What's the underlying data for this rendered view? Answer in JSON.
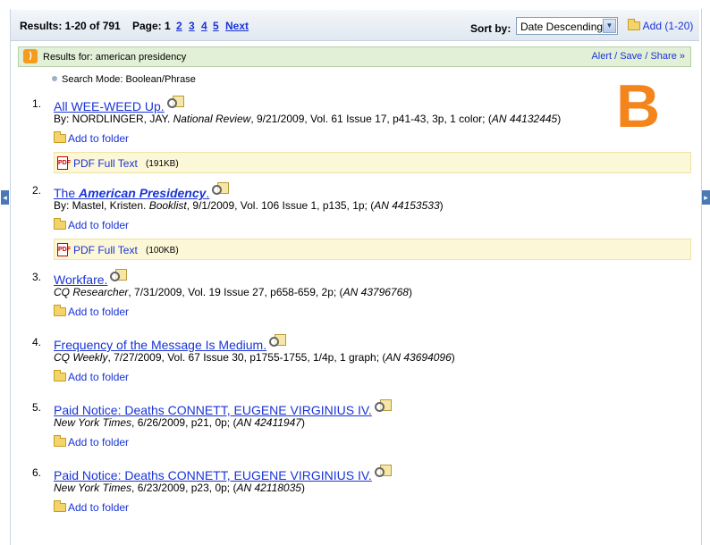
{
  "toolbar": {
    "results_count": "Results: 1-20 of 791",
    "page_label": "Page: 1",
    "pages": [
      "2",
      "3",
      "4",
      "5"
    ],
    "next": "Next",
    "sort_label": "Sort by:",
    "sort_value": "Date Descending",
    "add_label": "Add (1-20)"
  },
  "results_for": {
    "label": "Results for:",
    "query": "american presidency",
    "alert_link": "Alert / Save / Share »"
  },
  "search_mode": "Search Mode: Boolean/Phrase",
  "overlay_letter": "B",
  "add_to_folder": "Add to folder",
  "pdf_full_text": "PDF Full Text",
  "results": [
    {
      "num": "1.",
      "title": "All WEE-WEED Up.",
      "by": "By: NORDLINGER, JAY. ",
      "source": "National Review",
      "details": ", 9/21/2009, Vol. 61 Issue 17, p41-43, 3p, 1 color; (",
      "an": "AN 44132445",
      "close": ")",
      "pdf_size": "(191KB)"
    },
    {
      "num": "2.",
      "title_prefix": "The ",
      "title_emph": "American Presidency",
      "title_suffix": ".",
      "by": "By: Mastel, Kristen. ",
      "source": "Booklist",
      "details": ", 9/1/2009, Vol. 106 Issue 1, p135, 1p; (",
      "an": "AN 44153533",
      "close": ")",
      "pdf_size": "(100KB)"
    },
    {
      "num": "3.",
      "title": "Workfare.",
      "source": "CQ Researcher",
      "details": ", 7/31/2009, Vol. 19 Issue 27, p658-659, 2p; (",
      "an": "AN 43796768",
      "close": ")"
    },
    {
      "num": "4.",
      "title": "Frequency of the Message Is Medium.",
      "source": "CQ Weekly",
      "details": ", 7/27/2009, Vol. 67 Issue 30, p1755-1755, 1/4p, 1 graph; (",
      "an": "AN 43694096",
      "close": ")"
    },
    {
      "num": "5.",
      "title": "Paid Notice: Deaths CONNETT, EUGENE VIRGINIUS IV.",
      "source": "New York Times",
      "details": ", 6/26/2009, p21, 0p; (",
      "an": "AN 42411947",
      "close": ")"
    },
    {
      "num": "6.",
      "title": "Paid Notice: Deaths CONNETT, EUGENE VIRGINIUS IV.",
      "source": "New York Times",
      "details": ", 6/23/2009, p23, 0p; (",
      "an": "AN 42118035",
      "close": ")"
    }
  ]
}
